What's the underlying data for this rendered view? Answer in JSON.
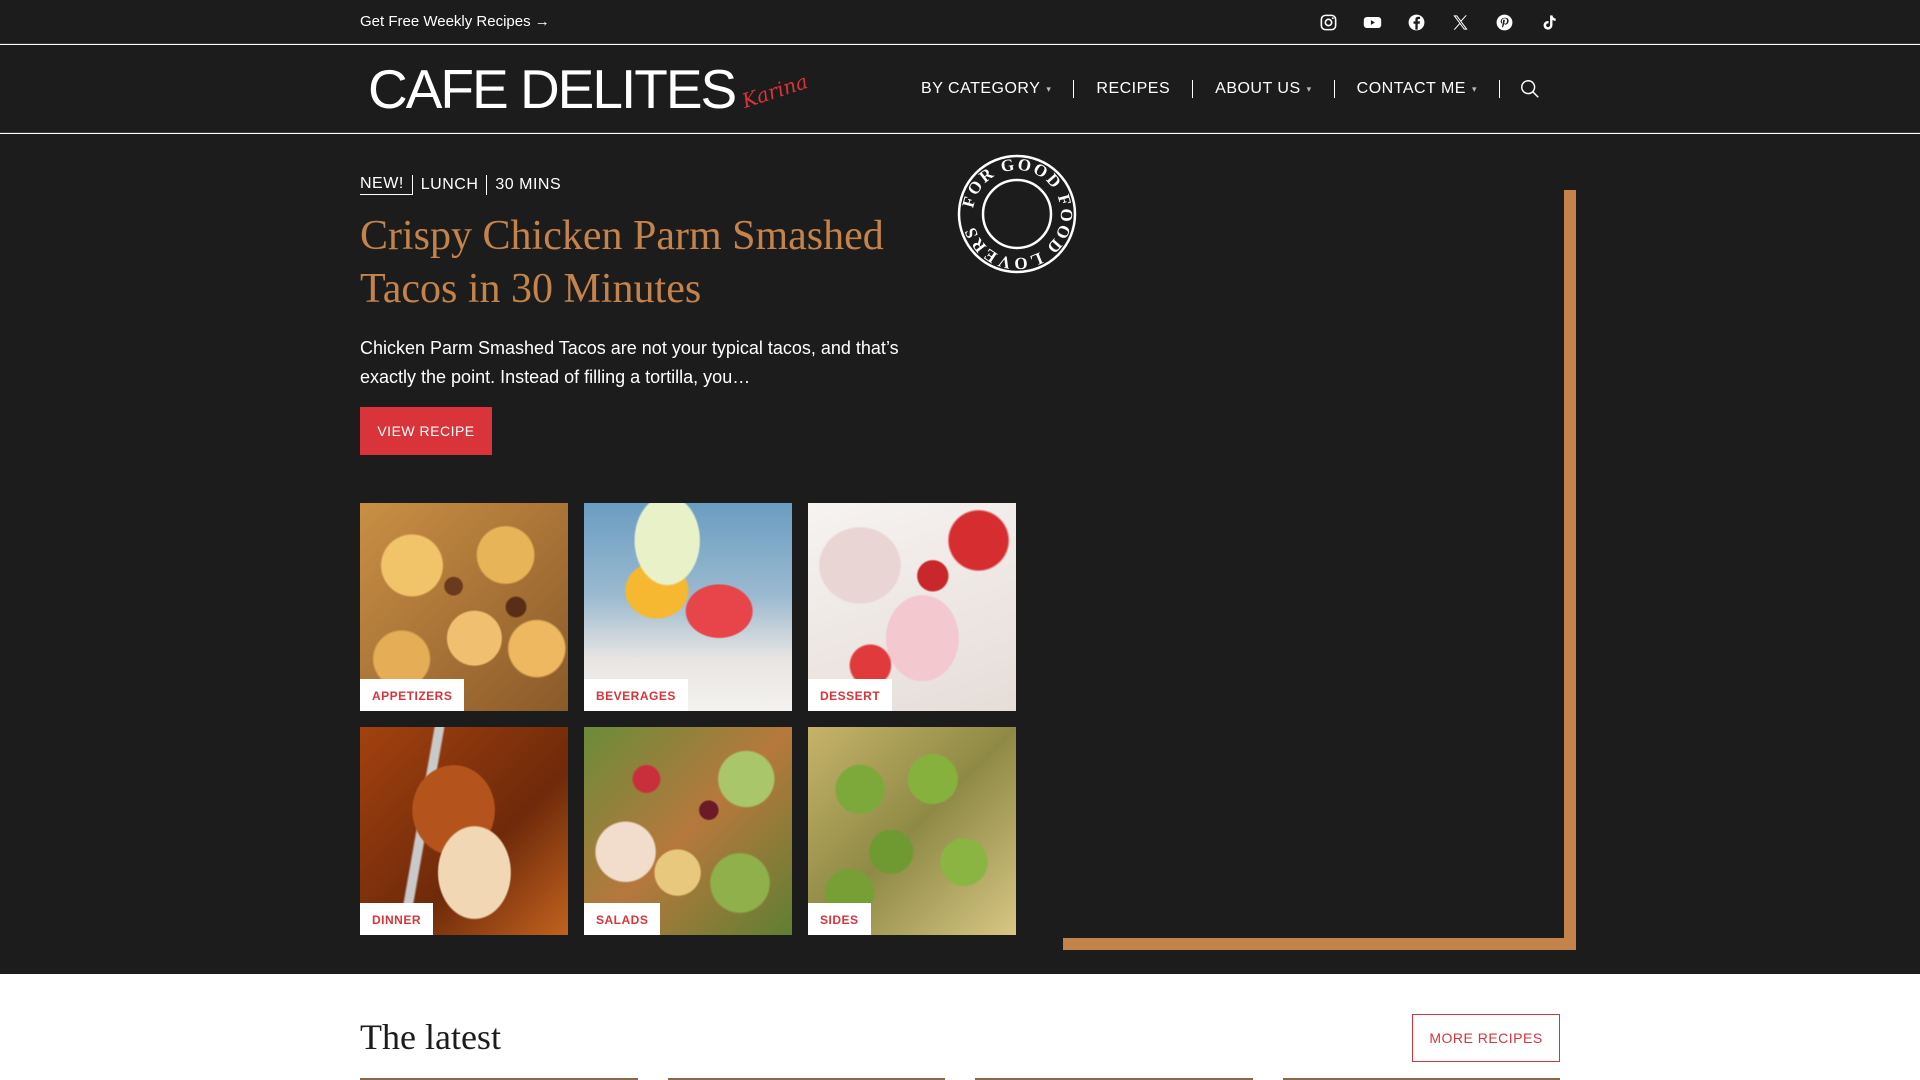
{
  "topbar": {
    "promo": "Get Free Weekly Recipes →",
    "social": [
      "instagram-icon",
      "youtube-icon",
      "facebook-icon",
      "x-icon",
      "pinterest-icon",
      "tiktok-icon"
    ]
  },
  "header": {
    "logo_text": "CAFE DELITES",
    "logo_signature": "Karina",
    "nav": [
      {
        "label": "BY CATEGORY"
      },
      {
        "label": "RECIPES"
      },
      {
        "label": "ABOUT US"
      },
      {
        "label": "CONTACT ME"
      }
    ]
  },
  "hero": {
    "tags": [
      "NEW!",
      "LUNCH",
      "30 MINS"
    ],
    "title": "Crispy Chicken Parm Smashed Tacos in 30 Minutes",
    "description": "Chicken Parm Smashed Tacos are not your typical tacos, and that’s exactly the point. Instead of filling a tortilla, you…",
    "button": "VIEW RECIPE",
    "badge_text": "FOR GOOD FOOD LOVERS"
  },
  "categories": [
    {
      "label": "APPETIZERS"
    },
    {
      "label": "BEVERAGES"
    },
    {
      "label": "DESSERT"
    },
    {
      "label": "DINNER"
    },
    {
      "label": "SALADS"
    },
    {
      "label": "SIDES"
    }
  ],
  "latest": {
    "title": "The latest",
    "button": "MORE RECIPES"
  },
  "colors": {
    "accent_red": "#d9343a",
    "accent_bronze": "#c4834b",
    "dark_bg": "#1c1c1c"
  }
}
